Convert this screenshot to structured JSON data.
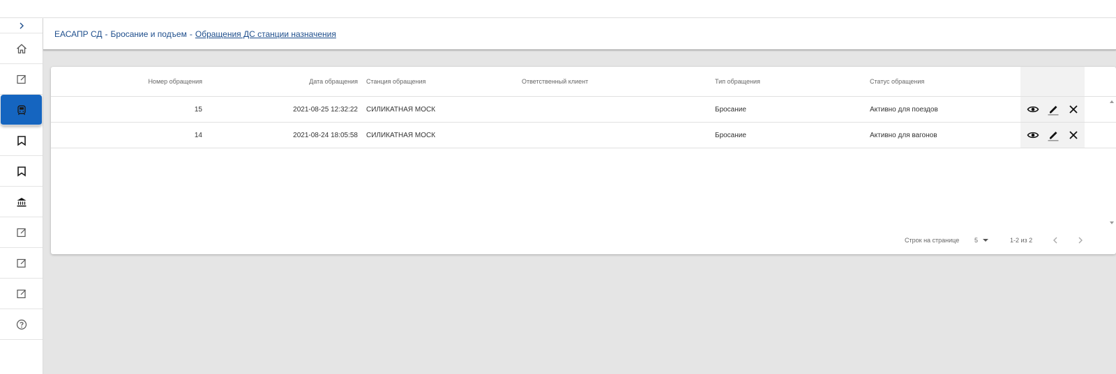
{
  "breadcrumb": {
    "root": "ЕАСАПР СД",
    "section": "Бросание и подъем",
    "current": "Обращения ДС станции назначения",
    "separator": "-"
  },
  "sidebar": {
    "toggle_icon": "chevron-right-icon",
    "items": [
      {
        "icon": "home-icon"
      },
      {
        "icon": "edit-note-icon"
      },
      {
        "icon": "train-icon",
        "active": true
      },
      {
        "icon": "bookmark-icon"
      },
      {
        "icon": "bookmark-icon"
      },
      {
        "icon": "bank-icon"
      },
      {
        "icon": "edit-note-icon"
      },
      {
        "icon": "edit-note-icon"
      },
      {
        "icon": "edit-note-icon"
      },
      {
        "icon": "help-icon"
      }
    ],
    "active_color": "#1565c0"
  },
  "table": {
    "columns": {
      "number": "Номер обращения",
      "date": "Дата обращения",
      "station": "Станция обращения",
      "client": "Ответственный клиент",
      "type": "Тип обращения",
      "status": "Статус обращения"
    },
    "rows": [
      {
        "number": "15",
        "date": "2021-08-25 12:32:22",
        "station": "СИЛИКАТНАЯ МОСК",
        "client": "",
        "type": "Бросание",
        "status": "Активно для поездов"
      },
      {
        "number": "14",
        "date": "2021-08-24 18:05:58",
        "station": "СИЛИКАТНАЯ МОСК",
        "client": "",
        "type": "Бросание",
        "status": "Активно для вагонов"
      }
    ],
    "row_actions": [
      "eye-icon",
      "pencil-icon",
      "close-icon"
    ]
  },
  "pagination": {
    "rows_per_page_label": "Строк на странице",
    "rows_per_page_value": "5",
    "range_label": "1-2 из 2"
  },
  "colors": {
    "accent": "#1565c0",
    "breadcrumb": "#1e4e8c",
    "background": "#e5e5e5"
  }
}
